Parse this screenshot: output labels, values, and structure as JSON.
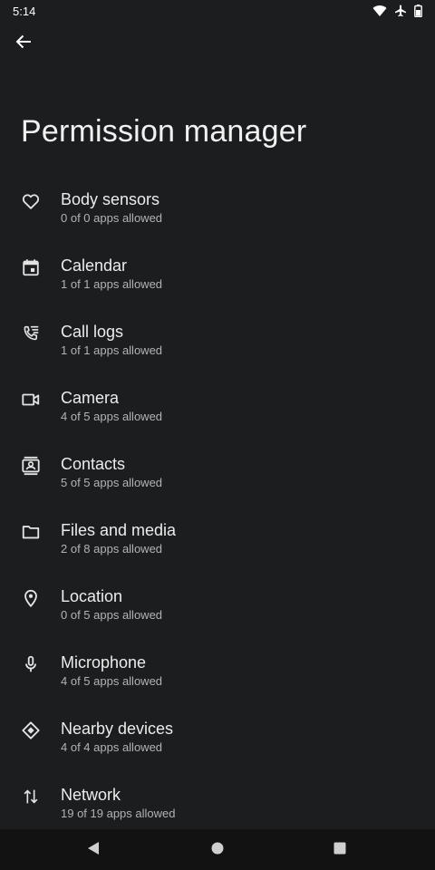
{
  "status": {
    "time": "5:14",
    "icons": [
      "wifi-icon",
      "airplane-icon",
      "battery-icon"
    ]
  },
  "header": {
    "back_icon": "arrow-back-icon",
    "title": "Permission manager"
  },
  "permissions": [
    {
      "icon": "heart-icon",
      "label": "Body sensors",
      "summary": "0 of 0 apps allowed"
    },
    {
      "icon": "calendar-icon",
      "label": "Calendar",
      "summary": "1 of 1 apps allowed"
    },
    {
      "icon": "call-log-icon",
      "label": "Call logs",
      "summary": "1 of 1 apps allowed"
    },
    {
      "icon": "video-camera-icon",
      "label": "Camera",
      "summary": "4 of 5 apps allowed"
    },
    {
      "icon": "contacts-icon",
      "label": "Contacts",
      "summary": "5 of 5 apps allowed"
    },
    {
      "icon": "folder-icon",
      "label": "Files and media",
      "summary": "2 of 8 apps allowed"
    },
    {
      "icon": "location-pin-icon",
      "label": "Location",
      "summary": "0 of 5 apps allowed"
    },
    {
      "icon": "microphone-icon",
      "label": "Microphone",
      "summary": "4 of 5 apps allowed"
    },
    {
      "icon": "nearby-devices-icon",
      "label": "Nearby devices",
      "summary": "4 of 4 apps allowed"
    },
    {
      "icon": "network-arrows-icon",
      "label": "Network",
      "summary": "19 of 19 apps allowed"
    }
  ],
  "navbar": {
    "icons": [
      "back-triangle-icon",
      "home-circle-icon",
      "recents-square-icon"
    ]
  },
  "colors": {
    "background": "#1b1d1f",
    "navbar": "#121212",
    "text": "#ececec",
    "subtext": "#b3b3b3"
  }
}
